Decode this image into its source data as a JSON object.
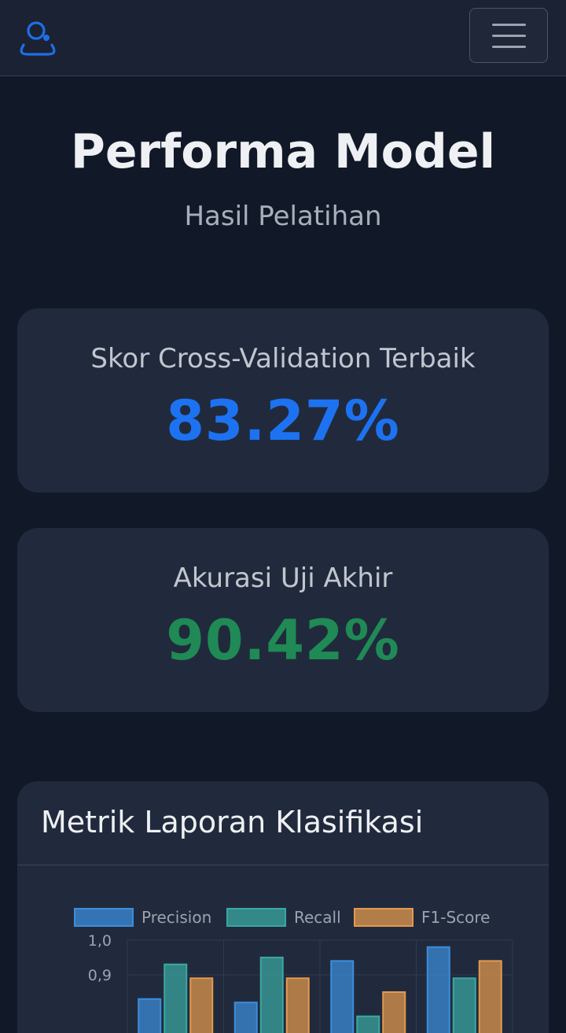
{
  "nav": {
    "logo_icon": "user-bubble-icon",
    "menu_icon": "hamburger-menu-icon"
  },
  "header": {
    "title": "Performa Model",
    "subtitle": "Hasil Pelatihan"
  },
  "cv_card": {
    "label": "Skor Cross-Validation Terbaik",
    "value": "83.27%",
    "color": "#1d72f2"
  },
  "test_card": {
    "label": "Akurasi Uji Akhir",
    "value": "90.42%",
    "color": "#1f8a55"
  },
  "metrics": {
    "title": "Metrik Laporan Klasifikasi"
  },
  "chart_data": {
    "type": "bar",
    "series": [
      {
        "name": "Precision",
        "color": "#3c8ddc",
        "values": [
          0.83,
          0.82,
          0.94,
          0.98
        ]
      },
      {
        "name": "Recall",
        "color": "#3aa8a2",
        "values": [
          0.93,
          0.95,
          0.78,
          0.89
        ]
      },
      {
        "name": "F1-Score",
        "color": "#e39a4e",
        "values": [
          0.89,
          0.89,
          0.85,
          0.94
        ]
      }
    ],
    "yticks": [
      "1,0",
      "0,9"
    ],
    "ylim": [
      0.5,
      1.0
    ],
    "grid": true,
    "legend": "top"
  }
}
